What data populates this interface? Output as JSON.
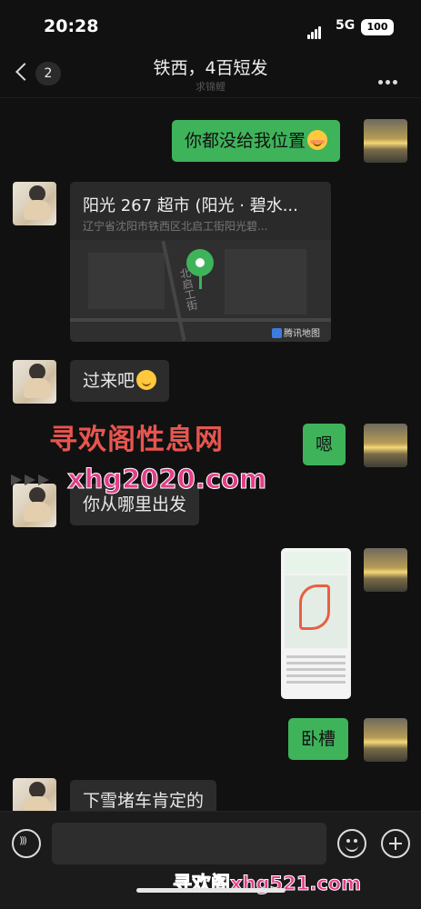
{
  "status_bar": {
    "time": "20:28",
    "network": "5G",
    "battery": "100"
  },
  "header": {
    "title": "铁西，4百短发",
    "unread_count": "2",
    "subtitle": "求锦鲤"
  },
  "messages": [
    {
      "side": "out",
      "text": "你都没给我位置",
      "emoji": "blush-face"
    },
    {
      "side": "in",
      "type": "location",
      "name": "阳光 267 超市 (阳光 · 碧水...",
      "address": "辽宁省沈阳市铁西区北启工街阳光碧...",
      "street": "北启工街",
      "map_brand": "腾讯地图"
    },
    {
      "side": "in",
      "text": "过来吧",
      "emoji": "smile-face"
    },
    {
      "side": "out",
      "text": "嗯"
    },
    {
      "side": "in",
      "text": "你从哪里出发"
    },
    {
      "side": "out",
      "type": "image",
      "description_icon": "map-screenshot"
    },
    {
      "side": "out",
      "text": "卧槽"
    },
    {
      "side": "in",
      "text": "下雪堵车肯定的"
    }
  ],
  "watermarks": {
    "top": "寻欢阁性息网",
    "middle": "xhg2020.com",
    "bottom": "寻欢阁xhg521.com"
  },
  "input": {
    "placeholder": ""
  }
}
